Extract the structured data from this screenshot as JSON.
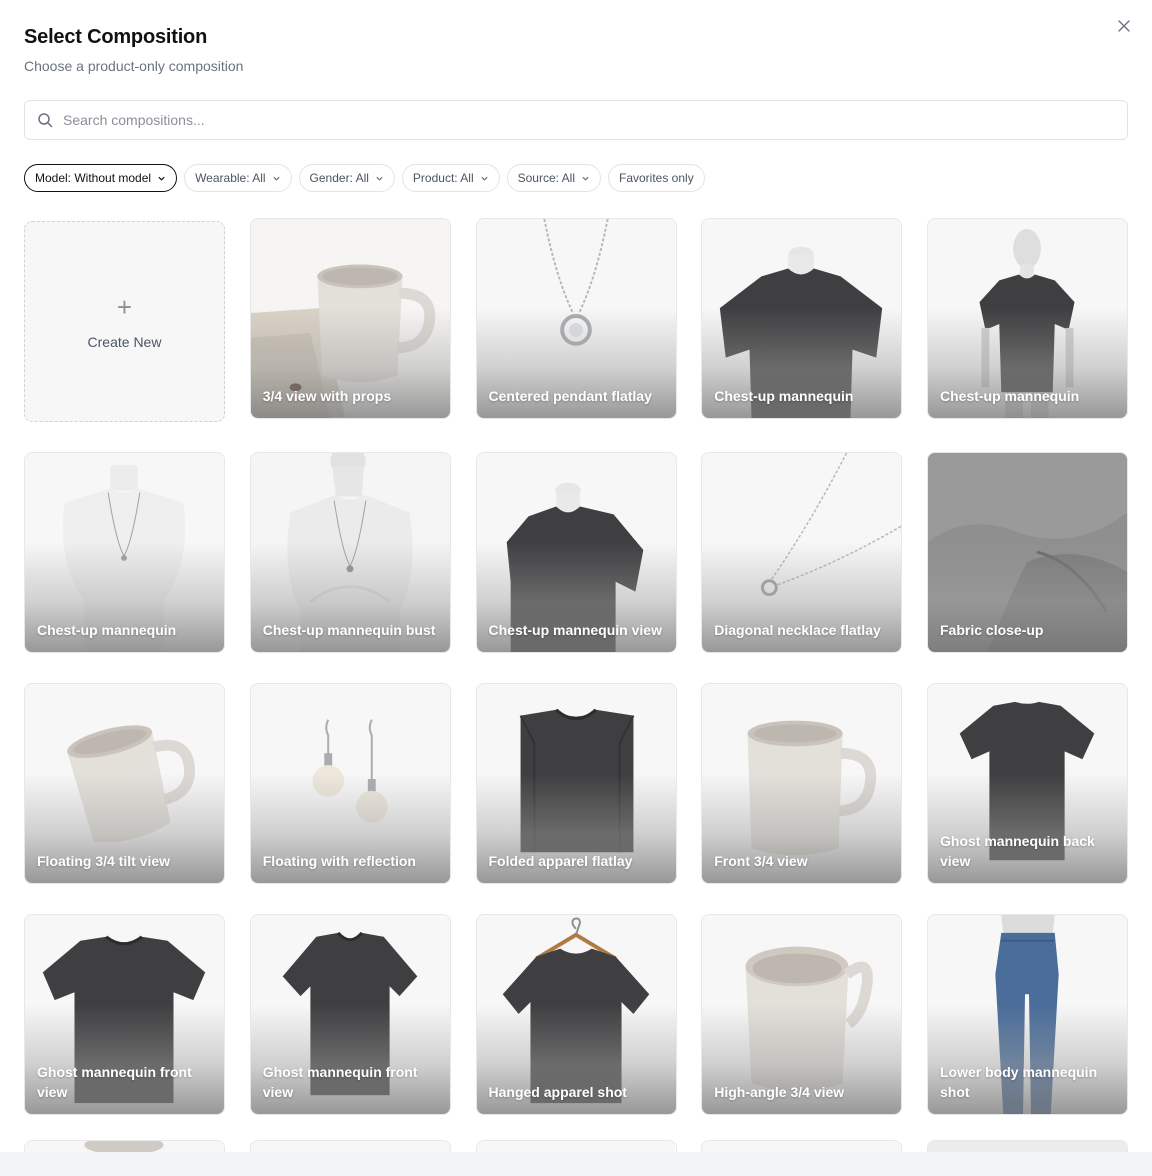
{
  "dialog": {
    "title": "Select Composition",
    "subtitle": "Choose a product-only composition",
    "close_icon": "close-icon"
  },
  "search": {
    "placeholder": "Search compositions...",
    "value": "",
    "icon": "search-icon"
  },
  "filters": [
    {
      "label": "Model: Without model",
      "active": true
    },
    {
      "label": "Wearable: All",
      "active": false
    },
    {
      "label": "Gender: All",
      "active": false
    },
    {
      "label": "Product: All",
      "active": false
    },
    {
      "label": "Source: All",
      "active": false
    },
    {
      "label": "Favorites only",
      "active": false
    }
  ],
  "create_card": {
    "label": "Create New",
    "icon": "plus-icon"
  },
  "compositions": [
    {
      "label": "3/4 view with props",
      "thumb": "mug-props"
    },
    {
      "label": "Centered pendant flatlay",
      "thumb": "pendant"
    },
    {
      "label": "Chest-up mannequin",
      "thumb": "tshirt-bust"
    },
    {
      "label": "Chest-up mannequin",
      "thumb": "tshirt-mannequin"
    },
    {
      "label": "Chest-up mannequin",
      "thumb": "necklace-bust"
    },
    {
      "label": "Chest-up mannequin bust",
      "thumb": "necklace-bust-white"
    },
    {
      "label": "Chest-up mannequin view",
      "thumb": "tshirt-bust-angle"
    },
    {
      "label": "Diagonal necklace flatlay",
      "thumb": "necklace-diagonal"
    },
    {
      "label": "Fabric close-up",
      "thumb": "fabric"
    },
    {
      "label": "Floating 3/4 tilt view",
      "thumb": "mug-tilt"
    },
    {
      "label": "Floating with reflection",
      "thumb": "earrings"
    },
    {
      "label": "Folded apparel flatlay",
      "thumb": "tshirt-folded"
    },
    {
      "label": "Front 3/4 view",
      "thumb": "mug-front"
    },
    {
      "label": "Ghost mannequin back view",
      "thumb": "tshirt-ghost-back"
    },
    {
      "label": "Ghost mannequin front view",
      "thumb": "tshirt-ghost-front"
    },
    {
      "label": "Ghost mannequin front view",
      "thumb": "tshirt-ghost-front-2"
    },
    {
      "label": "Hanged apparel shot",
      "thumb": "tshirt-hanger"
    },
    {
      "label": "High-angle 3/4 view",
      "thumb": "mug-high"
    },
    {
      "label": "Lower body mannequin shot",
      "thumb": "jeans"
    }
  ],
  "colors": {
    "shirt": "#3f3f41",
    "mug": "#dcd8d3",
    "jeans": "#4a6d9a",
    "silver": "#b5b8bc"
  }
}
